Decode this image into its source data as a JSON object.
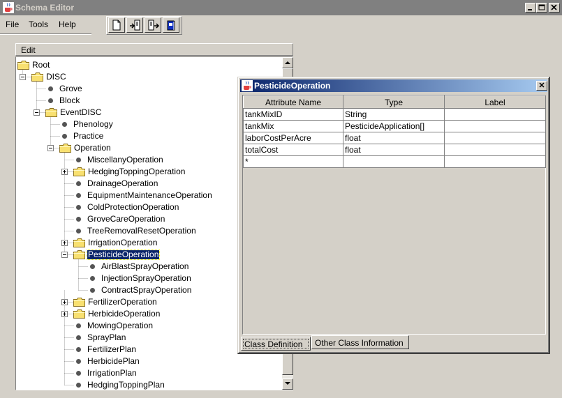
{
  "window": {
    "title": "Schema Editor"
  },
  "menu": {
    "items": [
      {
        "label": "File"
      },
      {
        "label": "Tools"
      },
      {
        "label": "Help"
      }
    ]
  },
  "toolbar": {
    "buttons": [
      {
        "icon": "new-document-icon"
      },
      {
        "icon": "import-icon"
      },
      {
        "icon": "export-icon"
      },
      {
        "icon": "book-icon"
      }
    ]
  },
  "edit_panel": {
    "header": "Edit"
  },
  "tree": {
    "nodes": [
      {
        "label": "Root",
        "type": "folder",
        "level": 0,
        "expander": ""
      },
      {
        "label": "DISC",
        "type": "folder",
        "level": 1,
        "expander": "minus"
      },
      {
        "label": "Grove",
        "type": "leaf",
        "level": 2
      },
      {
        "label": "Block",
        "type": "leaf",
        "level": 2
      },
      {
        "label": "EventDISC",
        "type": "folder",
        "level": 2,
        "expander": "minus"
      },
      {
        "label": "Phenology",
        "type": "leaf",
        "level": 3
      },
      {
        "label": "Practice",
        "type": "leaf",
        "level": 3
      },
      {
        "label": "Operation",
        "type": "folder",
        "level": 3,
        "expander": "minus"
      },
      {
        "label": "MiscellanyOperation",
        "type": "leaf",
        "level": 4
      },
      {
        "label": "HedgingToppingOperation",
        "type": "folder",
        "level": 4,
        "expander": "plus"
      },
      {
        "label": "DrainageOperation",
        "type": "leaf",
        "level": 4
      },
      {
        "label": "EquipmentMaintenanceOperation",
        "type": "leaf",
        "level": 4
      },
      {
        "label": "ColdProtectionOperation",
        "type": "leaf",
        "level": 4
      },
      {
        "label": "GroveCareOperation",
        "type": "leaf",
        "level": 4
      },
      {
        "label": "TreeRemovalResetOperation",
        "type": "leaf",
        "level": 4
      },
      {
        "label": "IrrigationOperation",
        "type": "folder",
        "level": 4,
        "expander": "plus"
      },
      {
        "label": "PesticideOperation",
        "type": "folder",
        "level": 4,
        "expander": "minus",
        "selected": true
      },
      {
        "label": "AirBlastSprayOperation",
        "type": "leaf",
        "level": 5
      },
      {
        "label": "InjectionSprayOperation",
        "type": "leaf",
        "level": 5
      },
      {
        "label": "ContractSprayOperation",
        "type": "leaf",
        "level": 5
      },
      {
        "label": "FertilizerOperation",
        "type": "folder",
        "level": 4,
        "expander": "plus"
      },
      {
        "label": "HerbicideOperation",
        "type": "folder",
        "level": 4,
        "expander": "plus"
      },
      {
        "label": "MowingOperation",
        "type": "leaf",
        "level": 4
      },
      {
        "label": "SprayPlan",
        "type": "leaf",
        "level": 4
      },
      {
        "label": "FertilizerPlan",
        "type": "leaf",
        "level": 4
      },
      {
        "label": "HerbicidePlan",
        "type": "leaf",
        "level": 4
      },
      {
        "label": "IrrigationPlan",
        "type": "leaf",
        "level": 4
      },
      {
        "label": "HedgingToppingPlan",
        "type": "leaf",
        "level": 4
      }
    ]
  },
  "dialog": {
    "title": "PesticideOperation",
    "columns": [
      "Attribute Name",
      "Type",
      "Label"
    ],
    "rows": [
      [
        "tankMixID",
        "String",
        ""
      ],
      [
        "tankMix",
        "PesticideApplication[]",
        ""
      ],
      [
        "laborCostPerAcre",
        "float",
        ""
      ],
      [
        "totalCost",
        "float",
        ""
      ],
      [
        "*",
        "",
        ""
      ]
    ],
    "tabs": [
      {
        "label": "Class Definition",
        "active": true
      },
      {
        "label": "Other Class Information",
        "active": false
      }
    ]
  }
}
